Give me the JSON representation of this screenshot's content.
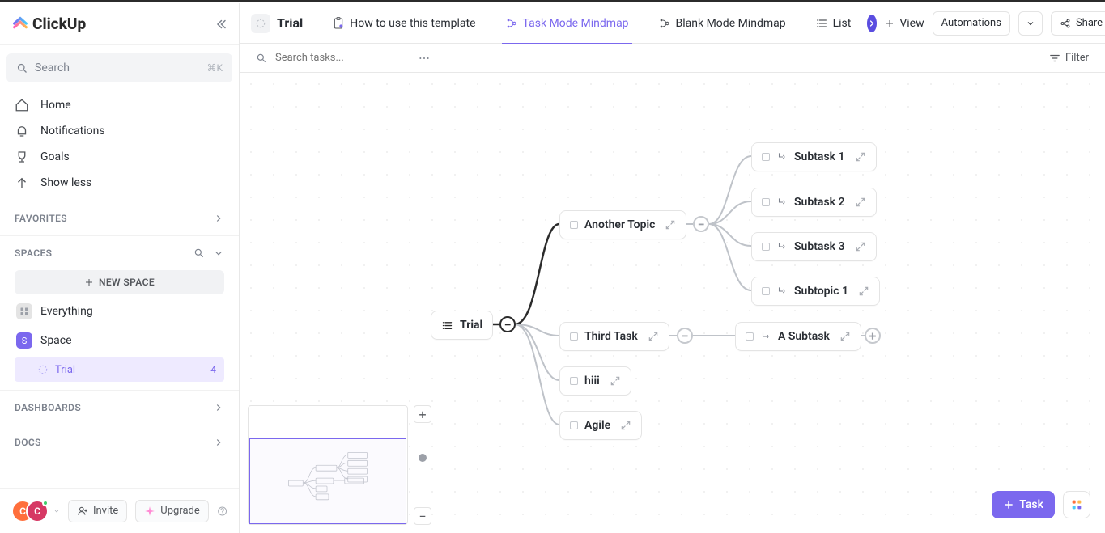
{
  "brand": "ClickUp",
  "colors": {
    "accent": "#7b68ee",
    "avatar1": "#ff6f3c",
    "avatar2": "#d63864"
  },
  "sidebar": {
    "search_placeholder": "Search",
    "search_shortcut": "⌘K",
    "nav": [
      {
        "label": "Home",
        "icon": "home-icon"
      },
      {
        "label": "Notifications",
        "icon": "bell-icon"
      },
      {
        "label": "Goals",
        "icon": "trophy-icon"
      },
      {
        "label": "Show less",
        "icon": "arrow-up-icon"
      }
    ],
    "favorites_label": "FAVORITES",
    "spaces_label": "SPACES",
    "new_space_label": "NEW SPACE",
    "everything_label": "Everything",
    "space_name": "Space",
    "active_list": {
      "name": "Trial",
      "count": "4"
    },
    "dashboards_label": "DASHBOARDS",
    "docs_label": "DOCS",
    "invite_label": "Invite",
    "upgrade_label": "Upgrade",
    "avatars": [
      "C",
      "C"
    ]
  },
  "header": {
    "list_name": "Trial",
    "tabs": [
      {
        "label": "How to use this template",
        "icon": "doc-clip-icon"
      },
      {
        "label": "Task Mode Mindmap",
        "icon": "mindmap-icon",
        "active": true
      },
      {
        "label": "Blank Mode Mindmap",
        "icon": "mindmap-icon"
      },
      {
        "label": "List",
        "icon": "list-icon"
      }
    ],
    "add_view_label": "View",
    "automations_label": "Automations",
    "share_label": "Share"
  },
  "toolbar": {
    "search_placeholder": "Search tasks...",
    "filter_label": "Filter"
  },
  "mindmap": {
    "root": {
      "label": "Trial"
    },
    "level1": [
      {
        "label": "Another Topic"
      },
      {
        "label": "Third Task"
      },
      {
        "label": "hiii"
      },
      {
        "label": "Agile"
      }
    ],
    "another_topic_children": [
      {
        "label": "Subtask 1"
      },
      {
        "label": "Subtask 2"
      },
      {
        "label": "Subtask 3"
      },
      {
        "label": "Subtopic 1"
      }
    ],
    "third_task_children": [
      {
        "label": "A Subtask"
      }
    ]
  },
  "fab": {
    "task_label": "Task"
  }
}
